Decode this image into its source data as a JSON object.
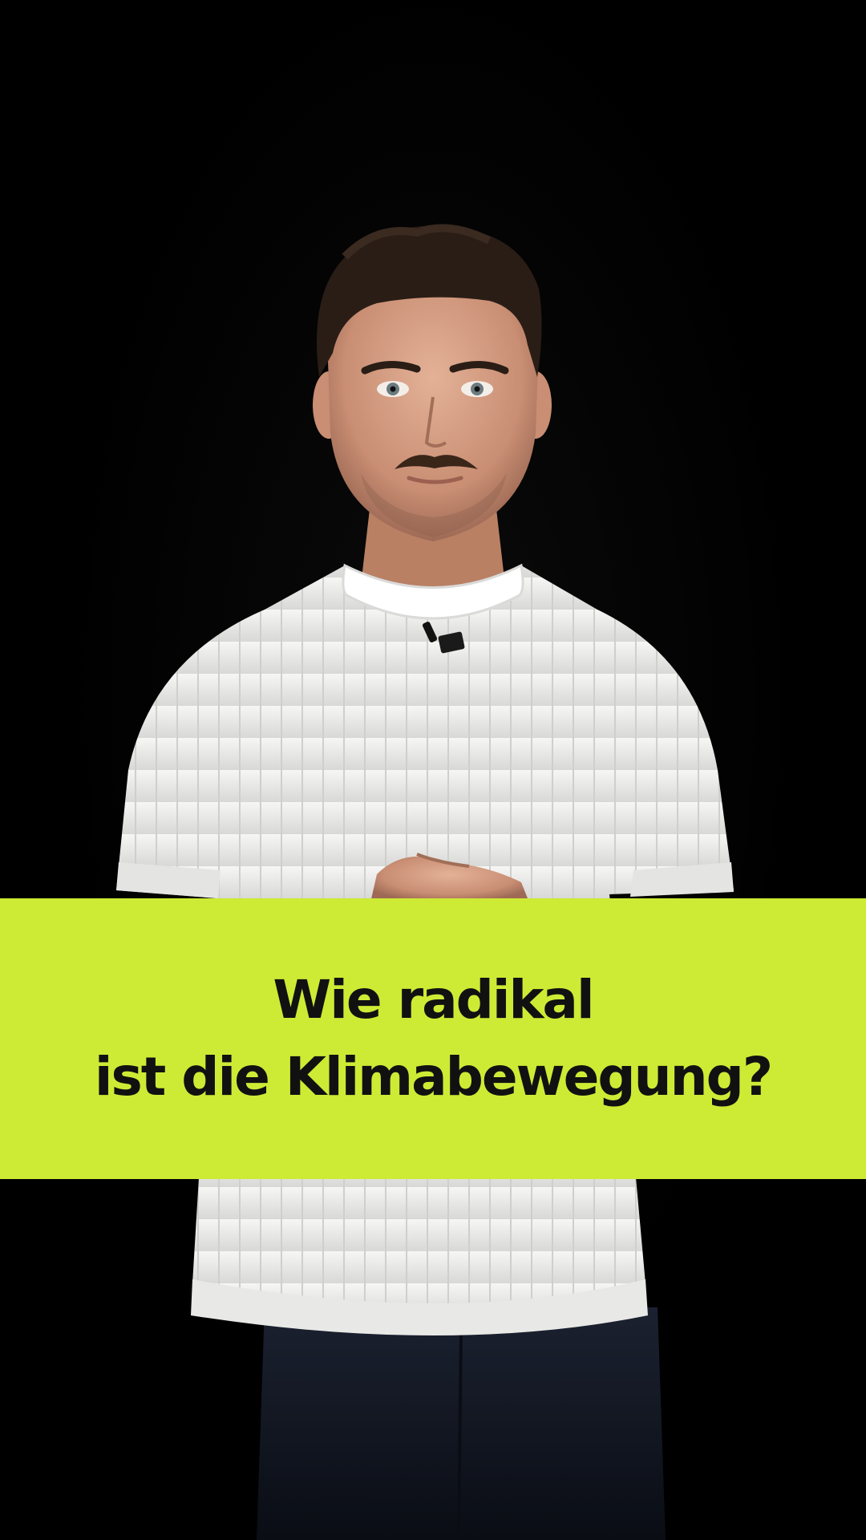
{
  "colors": {
    "background": "#000000",
    "banner": "#CDEB35",
    "title_text": "#111111",
    "shirt": "#F2F2F0",
    "skin": "#D9A48A",
    "hair": "#2A1D16",
    "jeans": "#161B26"
  },
  "banner": {
    "title_line_1": "Wie radikal",
    "title_line_2": "ist die Klimabewegung?"
  }
}
